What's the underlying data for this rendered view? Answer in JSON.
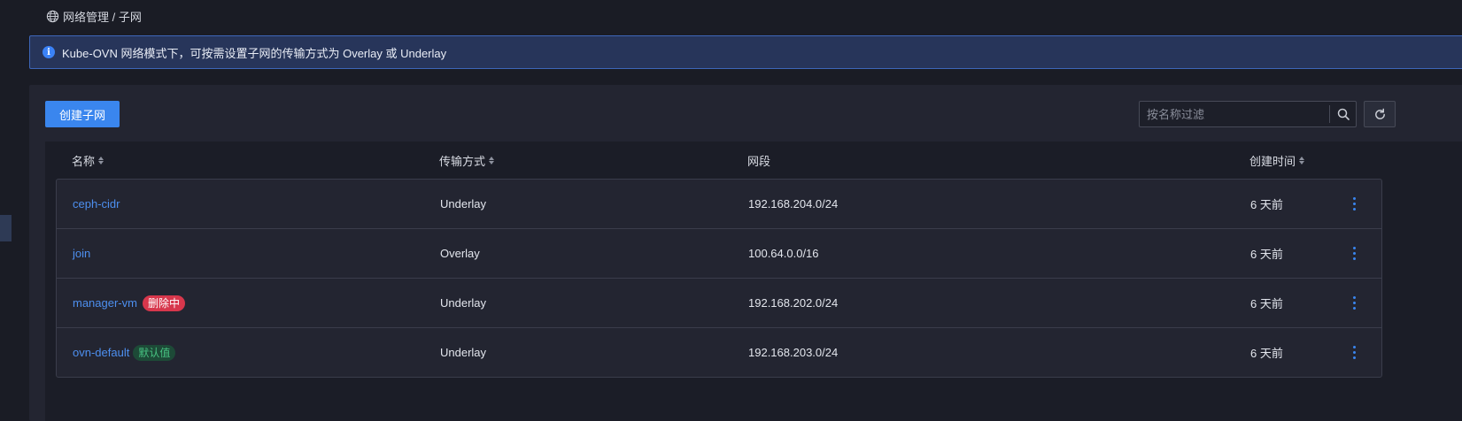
{
  "breadcrumb": {
    "text": "网络管理 / 子网",
    "icon": "globe-icon"
  },
  "alert": {
    "icon": "info-icon",
    "message": "Kube-OVN 网络模式下，可按需设置子网的传输方式为 Overlay 或 Underlay"
  },
  "toolbar": {
    "create_label": "创建子网",
    "search_placeholder": "按名称过滤",
    "search_icon": "search-icon",
    "refresh_icon": "refresh-icon"
  },
  "table": {
    "columns": [
      "名称",
      "传输方式",
      "网段",
      "创建时间"
    ],
    "rows": [
      {
        "name": "ceph-cidr",
        "tag": "",
        "transport": "Underlay",
        "cidr": "192.168.204.0/24",
        "created": "6 天前"
      },
      {
        "name": "join",
        "tag": "",
        "transport": "Overlay",
        "cidr": "100.64.0.0/16",
        "created": "6 天前"
      },
      {
        "name": "manager-vm",
        "tag": "删除中",
        "transport": "Underlay",
        "cidr": "192.168.202.0/24",
        "created": "6 天前"
      },
      {
        "name": "ovn-default",
        "tag": "默认值",
        "transport": "Underlay",
        "cidr": "192.168.203.0/24",
        "created": "6 天前"
      }
    ]
  },
  "colors": {
    "accent": "#3a86ee",
    "danger": "#d7374c",
    "success": "#47c281"
  }
}
